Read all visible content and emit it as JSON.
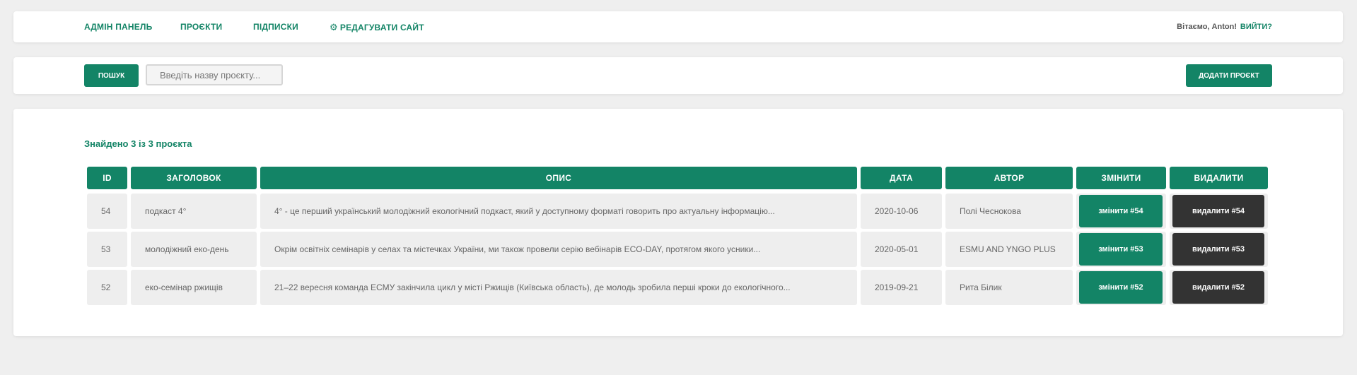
{
  "nav": {
    "admin": "АДМІН ПАНЕЛЬ",
    "projects": "ПРОЄКТИ",
    "subscriptions": "ПІДПИСКИ",
    "edit_site": "РЕДАГУВАТИ САЙТ",
    "greeting": "Вітаємо, Anton!",
    "logout": "ВИЙТИ?"
  },
  "toolbar": {
    "search_label": "ПОШУК",
    "search_placeholder": "Введіть назву проєкту...",
    "add_label": "ДОДАТИ ПРОЄКТ"
  },
  "results": {
    "found_text": "Знайдено 3 із 3 проєкта"
  },
  "table": {
    "headers": [
      "ID",
      "ЗАГОЛОВОК",
      "ОПИС",
      "ДАТА",
      "АВТОР",
      "ЗМІНИТИ",
      "ВИДАЛИТИ"
    ],
    "rows": [
      {
        "id": "54",
        "title": "подкаст 4°",
        "description": "4° - це перший український молодіжний екологічний подкаст, який у доступному форматі говорить про актуальну інформацію...",
        "date": "2020-10-06",
        "author": "Полі Чеснокова",
        "edit": "змінити #54",
        "delete": "видалити #54"
      },
      {
        "id": "53",
        "title": "молодіжний еко-день",
        "description": "Окрім освітніх семінарів у селах та містечках України, ми також провели серію вебінарів ECO-DAY, протягом якого усники...",
        "date": "2020-05-01",
        "author": "ESMU AND YNGO PLUS",
        "edit": "змінити #53",
        "delete": "видалити #53"
      },
      {
        "id": "52",
        "title": "еко-семінар ржищів",
        "description": "21–22 вересня команда ЕСМУ закінчила цикл у місті Ржищів (Київська область), де молодь зробила перші кроки до екологічного...",
        "date": "2019-09-21",
        "author": "Рита Білик",
        "edit": "змінити #52",
        "delete": "видалити #52"
      }
    ]
  },
  "colors": {
    "accent": "#138466",
    "delete": "#333333",
    "background": "#efefef"
  },
  "icons": {
    "edit_site": "gear-icon"
  }
}
